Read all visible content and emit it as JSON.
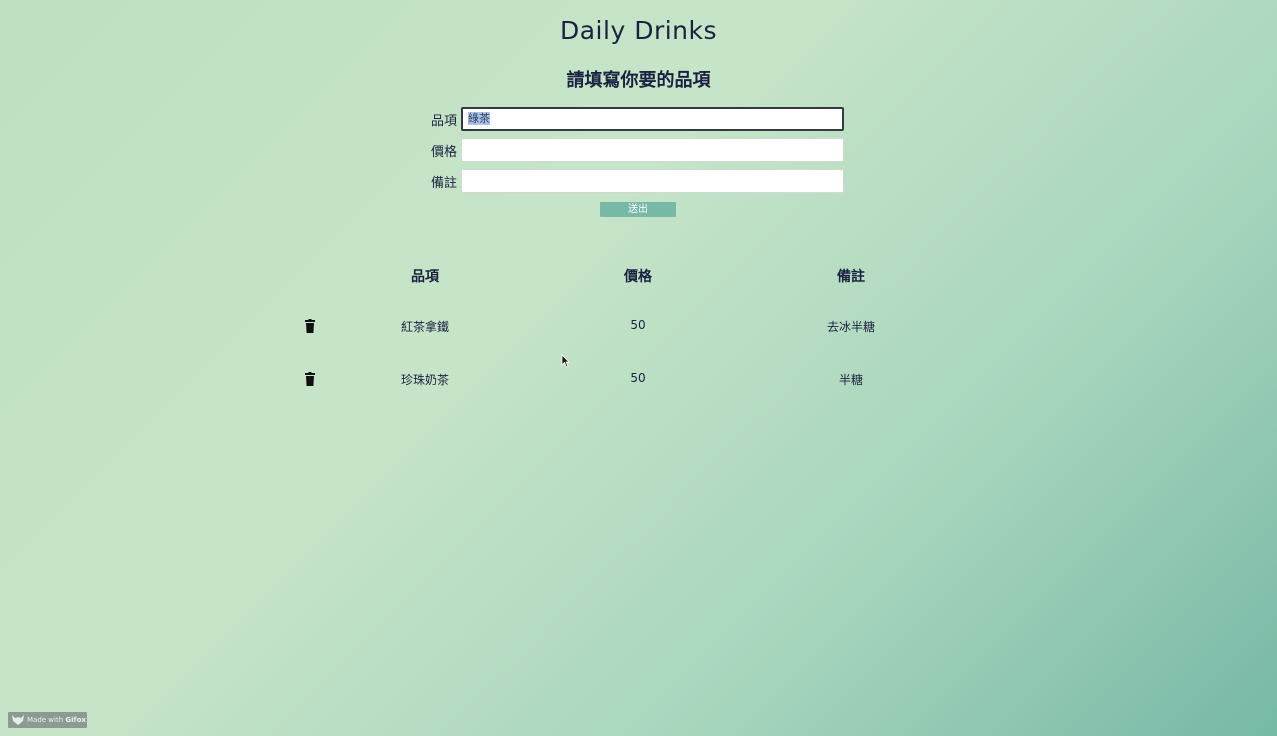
{
  "header": {
    "title": "Daily Drinks",
    "subtitle": "請填寫你要的品項"
  },
  "form": {
    "item_label": "品項",
    "item_value": "綠茶",
    "price_label": "價格",
    "price_value": "",
    "note_label": "備註",
    "note_value": "",
    "submit_label": "送出"
  },
  "table": {
    "headers": [
      "品項",
      "價格",
      "備註"
    ],
    "rows": [
      {
        "item": "紅茶拿鐵",
        "price": "50",
        "note": "去冰半糖"
      },
      {
        "item": "珍珠奶茶",
        "price": "50",
        "note": "半糖"
      }
    ]
  },
  "watermark": {
    "prefix": "Made with ",
    "brand": "Gifox"
  },
  "colors": {
    "accent": "#77b8a6",
    "text": "#1b2240"
  },
  "icons": {
    "delete": "trash-icon",
    "watermark": "gifox-logo-icon",
    "pointer": "mouse-cursor-icon"
  }
}
